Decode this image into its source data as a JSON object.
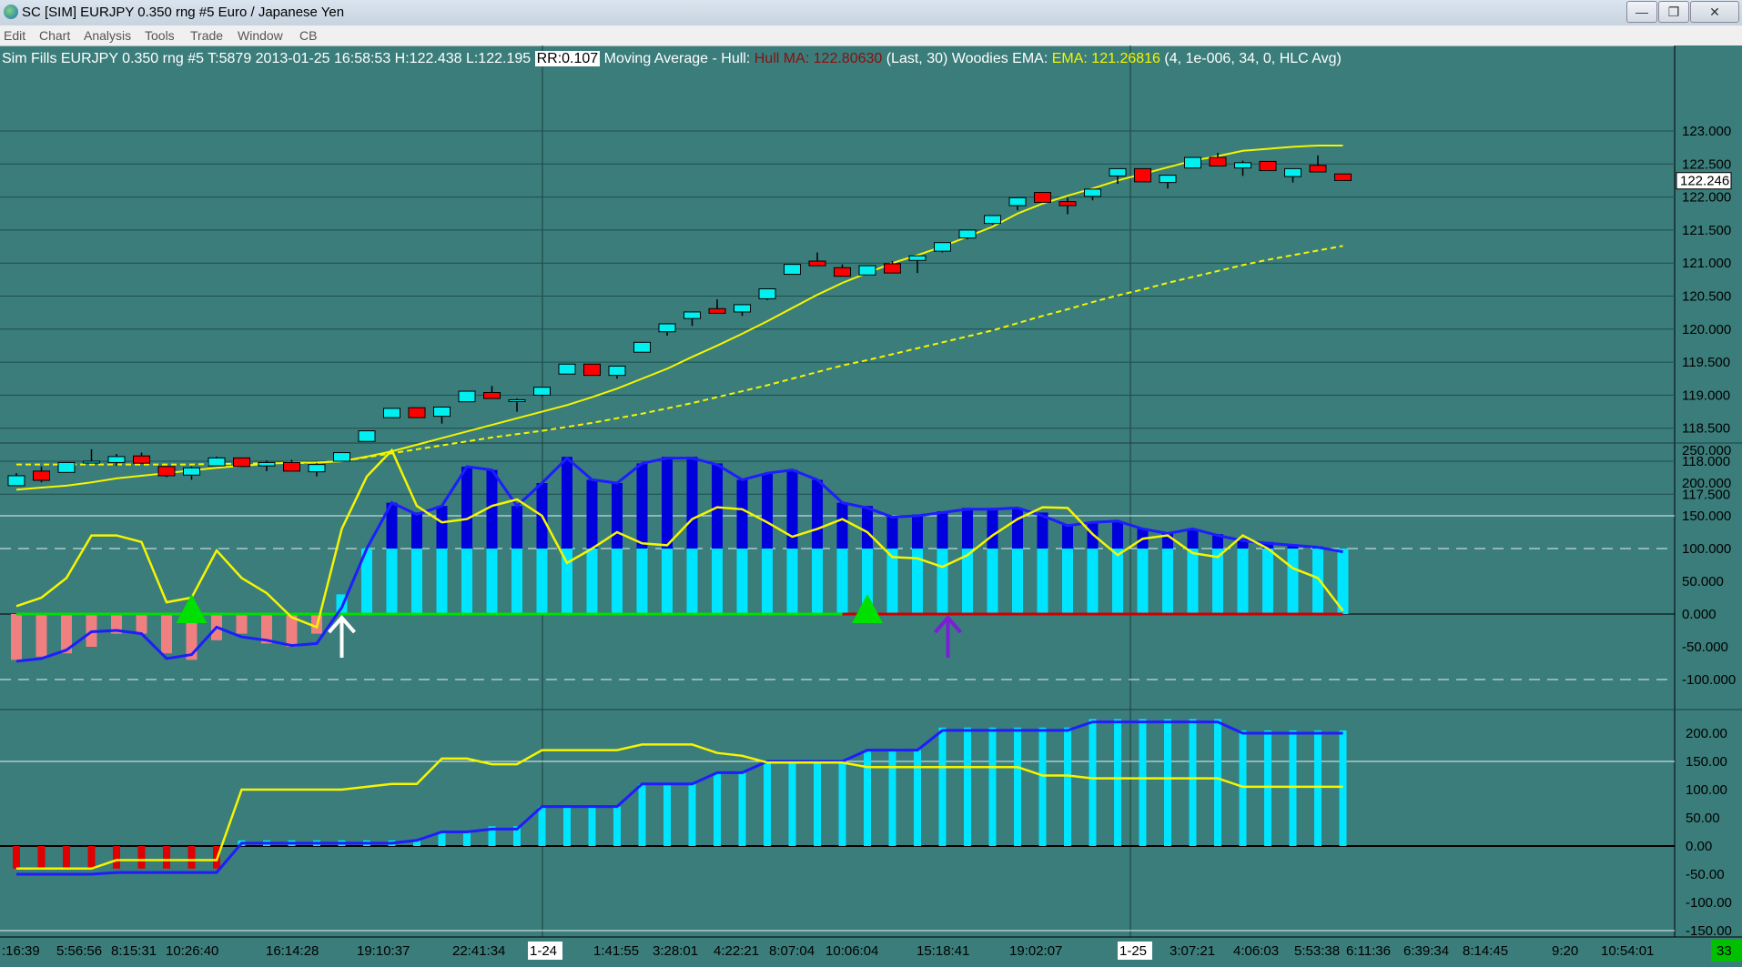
{
  "window": {
    "title": "SC [SIM] EURJPY  0.350 rng  #5  Euro / Japanese Yen",
    "minimize": "—",
    "restore": "❐",
    "close": "✕"
  },
  "menu": [
    "Edit",
    "Chart",
    "Analysis",
    "Tools",
    "Trade",
    "Window",
    "CB"
  ],
  "info": {
    "prefix": "Sim Fills  EURJPY  0.350 rng  #5 T:5879 2013-01-25 16:58:53 H:122.438 L:122.195",
    "rr": "RR:0.107",
    "study1": " Moving Average - Hull:  ",
    "hull": "Hull MA: 122.80630",
    "study1_params": "  (Last, 30)  Woodies EMA:  ",
    "ema": "EMA: 121.26816",
    "study2_params": "  (4, 1e-006, 34, 0, HLC Avg)"
  },
  "colors": {
    "background": "#3a7d7b",
    "up_candle": "#00f0f0",
    "down_candle": "#ff0000",
    "hull_ma": "#f5f500",
    "ema": "#f5f500",
    "cci_histogram_up": "#00e5ff",
    "cci_histogram_dark": "#0000dd",
    "cci_line": "#1d1dff",
    "arrow_white": "#ffffff",
    "arrow_purple": "#7b1fd6",
    "triangle_green": "#00e000"
  },
  "price_axis": {
    "labels": [
      "123.000",
      "122.500",
      "122.000",
      "121.500",
      "121.000",
      "120.500",
      "120.000",
      "119.500",
      "119.000",
      "118.500",
      "118.000",
      "117.500"
    ],
    "current": "122.246"
  },
  "cci_axis": {
    "labels": [
      "250.000",
      "200.000",
      "150.000",
      "100.000",
      "50.000",
      "0.000",
      "-50.000",
      "-100.000"
    ]
  },
  "lower_axis": {
    "labels": [
      "200.00",
      "150.00",
      "100.00",
      "50.00",
      "0.00",
      "-50.00",
      "-100.00",
      "-150.00"
    ]
  },
  "time_axis": {
    "labels": [
      ":16:39",
      "5:56:56",
      "8:15:31",
      "10:26:40",
      "16:14:28",
      "19:10:37",
      "22:41:34",
      "1-24",
      "1:41:55",
      "3:28:01",
      "4:22:21",
      "8:07:04",
      "10:06:04",
      "15:18:41",
      "19:02:07",
      "1-25",
      "3:07:21",
      "4:06:03",
      "5:53:38",
      "6:11:36",
      "6:39:34",
      "8:14:45",
      "9:20",
      "10:54:01"
    ],
    "counter": "33"
  },
  "chart_data": {
    "type": "candlestick",
    "price_range": [
      117.25,
      123.1
    ],
    "candles": [
      {
        "o": 117.63,
        "h": 117.82,
        "l": 117.63,
        "c": 117.78
      },
      {
        "o": 117.85,
        "h": 117.92,
        "l": 117.68,
        "c": 117.71
      },
      {
        "o": 117.83,
        "h": 117.98,
        "l": 117.83,
        "c": 117.98
      },
      {
        "o": 117.98,
        "h": 118.18,
        "l": 117.98,
        "c": 118.0
      },
      {
        "o": 117.98,
        "h": 118.11,
        "l": 117.93,
        "c": 118.07
      },
      {
        "o": 118.08,
        "h": 118.13,
        "l": 117.96,
        "c": 117.97
      },
      {
        "o": 117.92,
        "h": 117.92,
        "l": 117.76,
        "c": 117.78
      },
      {
        "o": 117.79,
        "h": 117.92,
        "l": 117.72,
        "c": 117.9
      },
      {
        "o": 117.93,
        "h": 118.07,
        "l": 117.93,
        "c": 118.05
      },
      {
        "o": 118.05,
        "h": 118.05,
        "l": 117.91,
        "c": 117.92
      },
      {
        "o": 117.93,
        "h": 118.01,
        "l": 117.85,
        "c": 117.98
      },
      {
        "o": 117.98,
        "h": 118.02,
        "l": 117.85,
        "c": 117.85
      },
      {
        "o": 117.84,
        "h": 117.97,
        "l": 117.77,
        "c": 117.95
      },
      {
        "o": 118.0,
        "h": 118.13,
        "l": 118.0,
        "c": 118.13
      },
      {
        "o": 118.3,
        "h": 118.46,
        "l": 118.3,
        "c": 118.46
      },
      {
        "o": 118.66,
        "h": 118.8,
        "l": 118.66,
        "c": 118.8
      },
      {
        "o": 118.81,
        "h": 118.81,
        "l": 118.66,
        "c": 118.66
      },
      {
        "o": 118.68,
        "h": 118.82,
        "l": 118.57,
        "c": 118.82
      },
      {
        "o": 118.9,
        "h": 119.06,
        "l": 118.9,
        "c": 119.06
      },
      {
        "o": 119.04,
        "h": 119.14,
        "l": 118.95,
        "c": 118.95
      },
      {
        "o": 118.92,
        "h": 118.95,
        "l": 118.75,
        "c": 118.93
      },
      {
        "o": 119.0,
        "h": 119.12,
        "l": 118.98,
        "c": 119.12
      },
      {
        "o": 119.32,
        "h": 119.47,
        "l": 119.32,
        "c": 119.47
      },
      {
        "o": 119.47,
        "h": 119.47,
        "l": 119.3,
        "c": 119.3
      },
      {
        "o": 119.3,
        "h": 119.44,
        "l": 119.25,
        "c": 119.44
      },
      {
        "o": 119.65,
        "h": 119.8,
        "l": 119.65,
        "c": 119.8
      },
      {
        "o": 119.96,
        "h": 120.08,
        "l": 119.9,
        "c": 120.08
      },
      {
        "o": 120.16,
        "h": 120.26,
        "l": 120.05,
        "c": 120.26
      },
      {
        "o": 120.31,
        "h": 120.45,
        "l": 120.24,
        "c": 120.24
      },
      {
        "o": 120.26,
        "h": 120.37,
        "l": 120.2,
        "c": 120.37
      },
      {
        "o": 120.46,
        "h": 120.61,
        "l": 120.44,
        "c": 120.61
      },
      {
        "o": 120.83,
        "h": 120.98,
        "l": 120.83,
        "c": 120.98
      },
      {
        "o": 121.03,
        "h": 121.16,
        "l": 120.96,
        "c": 120.96
      },
      {
        "o": 120.93,
        "h": 120.98,
        "l": 120.8,
        "c": 120.8
      },
      {
        "o": 120.82,
        "h": 120.96,
        "l": 120.82,
        "c": 120.96
      },
      {
        "o": 120.99,
        "h": 121.03,
        "l": 120.85,
        "c": 120.85
      },
      {
        "o": 121.04,
        "h": 121.11,
        "l": 120.85,
        "c": 121.11
      },
      {
        "o": 121.18,
        "h": 121.31,
        "l": 121.16,
        "c": 121.31
      },
      {
        "o": 121.38,
        "h": 121.5,
        "l": 121.36,
        "c": 121.5
      },
      {
        "o": 121.6,
        "h": 121.72,
        "l": 121.58,
        "c": 121.72
      },
      {
        "o": 121.87,
        "h": 121.99,
        "l": 121.8,
        "c": 121.99
      },
      {
        "o": 122.07,
        "h": 122.07,
        "l": 121.92,
        "c": 121.92
      },
      {
        "o": 121.93,
        "h": 121.99,
        "l": 121.74,
        "c": 121.87
      },
      {
        "o": 122.01,
        "h": 122.12,
        "l": 121.95,
        "c": 122.12
      },
      {
        "o": 122.32,
        "h": 122.43,
        "l": 122.2,
        "c": 122.43
      },
      {
        "o": 122.43,
        "h": 122.43,
        "l": 122.23,
        "c": 122.23
      },
      {
        "o": 122.22,
        "h": 122.33,
        "l": 122.13,
        "c": 122.33
      },
      {
        "o": 122.44,
        "h": 122.6,
        "l": 122.44,
        "c": 122.6
      },
      {
        "o": 122.6,
        "h": 122.67,
        "l": 122.47,
        "c": 122.47
      },
      {
        "o": 122.44,
        "h": 122.55,
        "l": 122.32,
        "c": 122.52
      },
      {
        "o": 122.54,
        "h": 122.54,
        "l": 122.4,
        "c": 122.4
      },
      {
        "o": 122.31,
        "h": 122.42,
        "l": 122.22,
        "c": 122.43
      },
      {
        "o": 122.48,
        "h": 122.63,
        "l": 122.38,
        "c": 122.38
      },
      {
        "o": 122.35,
        "h": 122.35,
        "l": 122.25,
        "c": 122.25
      }
    ],
    "hull_ma": [
      117.57,
      117.6,
      117.63,
      117.68,
      117.74,
      117.78,
      117.82,
      117.86,
      117.9,
      117.93,
      117.96,
      117.98,
      117.98,
      118.0,
      118.07,
      118.15,
      118.25,
      118.35,
      118.45,
      118.55,
      118.65,
      118.75,
      118.85,
      118.97,
      119.1,
      119.25,
      119.4,
      119.58,
      119.75,
      119.93,
      120.12,
      120.32,
      120.52,
      120.7,
      120.85,
      121.0,
      121.12,
      121.25,
      121.4,
      121.55,
      121.75,
      121.9,
      122.02,
      122.13,
      122.25,
      122.35,
      122.45,
      122.55,
      122.62,
      122.7,
      122.73,
      122.76,
      122.78,
      122.78
    ],
    "woodies_ema": [
      117.95,
      117.95,
      117.95,
      117.95,
      117.95,
      117.95,
      117.95,
      117.95,
      117.96,
      117.96,
      117.97,
      117.97,
      117.98,
      118.0,
      118.06,
      118.12,
      118.18,
      118.24,
      118.3,
      118.36,
      118.41,
      118.46,
      118.52,
      118.58,
      118.65,
      118.72,
      118.8,
      118.88,
      118.97,
      119.06,
      119.15,
      119.25,
      119.35,
      119.45,
      119.53,
      119.62,
      119.71,
      119.8,
      119.89,
      119.98,
      120.09,
      120.2,
      120.3,
      120.41,
      120.51,
      120.6,
      120.7,
      120.79,
      120.88,
      120.97,
      121.05,
      121.12,
      121.19,
      121.26
    ],
    "cci_histogram": [
      -70,
      -65,
      -60,
      -50,
      -30,
      -30,
      -60,
      -70,
      -40,
      -30,
      -45,
      -50,
      -30,
      30,
      100,
      100,
      100,
      100,
      100,
      100,
      100,
      100,
      100,
      100,
      100,
      100,
      100,
      100,
      100,
      100,
      100,
      100,
      100,
      100,
      100,
      100,
      100,
      100,
      100,
      100,
      100,
      100,
      100,
      100,
      100,
      100,
      100,
      100,
      100,
      100,
      100,
      100,
      100,
      100
    ],
    "cci_histogram_top": [
      0,
      0,
      0,
      0,
      0,
      0,
      0,
      0,
      0,
      0,
      0,
      0,
      0,
      0,
      100,
      170,
      155,
      165,
      225,
      220,
      165,
      200,
      240,
      205,
      200,
      230,
      240,
      240,
      230,
      205,
      215,
      220,
      205,
      170,
      165,
      150,
      152,
      157,
      162,
      162,
      162,
      155,
      137,
      140,
      140,
      130,
      125,
      130,
      122,
      115,
      110,
      105,
      103,
      95
    ],
    "cci_line": [
      -72,
      -68,
      -55,
      -27,
      -25,
      -30,
      -68,
      -62,
      -20,
      -35,
      -40,
      -48,
      -45,
      10,
      100,
      170,
      152,
      165,
      225,
      220,
      165,
      200,
      238,
      205,
      200,
      230,
      238,
      238,
      228,
      205,
      215,
      220,
      205,
      170,
      162,
      148,
      150,
      155,
      160,
      160,
      162,
      150,
      135,
      140,
      142,
      130,
      123,
      130,
      120,
      112,
      108,
      105,
      102,
      95
    ],
    "cci_yellow": [
      12,
      25,
      55,
      120,
      120,
      110,
      18,
      25,
      97,
      55,
      32,
      -5,
      -20,
      130,
      210,
      250,
      165,
      140,
      145,
      165,
      175,
      150,
      78,
      100,
      125,
      108,
      105,
      145,
      163,
      160,
      140,
      118,
      130,
      145,
      125,
      87,
      85,
      72,
      90,
      120,
      145,
      163,
      162,
      122,
      90,
      115,
      120,
      93,
      87,
      120,
      100,
      70,
      55,
      5
    ],
    "cci_range": [
      -120,
      250
    ],
    "lower_bars": [
      -40,
      -40,
      -40,
      -40,
      -40,
      -40,
      -40,
      -40,
      -40,
      10,
      10,
      10,
      10,
      10,
      10,
      10,
      10,
      25,
      25,
      35,
      35,
      70,
      70,
      70,
      70,
      110,
      110,
      110,
      130,
      130,
      150,
      150,
      150,
      150,
      170,
      170,
      170,
      210,
      210,
      210,
      210,
      210,
      210,
      225,
      225,
      225,
      225,
      225,
      225,
      205,
      205,
      205,
      205,
      205
    ],
    "lower_blue": [
      -50,
      -50,
      -50,
      -50,
      -47,
      -47,
      -47,
      -47,
      -47,
      5,
      5,
      5,
      5,
      5,
      5,
      5,
      10,
      25,
      25,
      30,
      30,
      70,
      70,
      70,
      70,
      110,
      110,
      110,
      130,
      130,
      150,
      150,
      150,
      150,
      170,
      170,
      170,
      205,
      205,
      205,
      205,
      205,
      205,
      220,
      220,
      220,
      220,
      220,
      220,
      200,
      200,
      200,
      200,
      200
    ],
    "lower_yellow": [
      -40,
      -40,
      -40,
      -40,
      -25,
      -25,
      -25,
      -25,
      -25,
      100,
      100,
      100,
      100,
      100,
      105,
      110,
      110,
      155,
      155,
      145,
      145,
      170,
      170,
      170,
      170,
      180,
      180,
      180,
      165,
      160,
      148,
      148,
      148,
      148,
      140,
      140,
      140,
      140,
      140,
      140,
      140,
      125,
      125,
      120,
      120,
      120,
      120,
      120,
      120,
      105,
      105,
      105,
      105,
      105
    ],
    "lower_range": [
      -160,
      230
    ],
    "signals": {
      "green_triangles_at": [
        7,
        34
      ],
      "white_up_arrow_at": 13,
      "purple_up_arrow_at": 37
    }
  }
}
